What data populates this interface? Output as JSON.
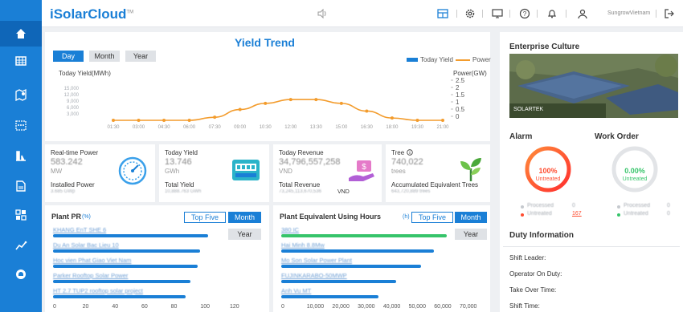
{
  "sidebar": {
    "items": [
      "home-icon",
      "grid-icon",
      "map-icon",
      "calendar-icon",
      "chart-icon",
      "report-icon",
      "apps-icon",
      "trend-icon",
      "support-icon"
    ]
  },
  "header": {
    "logo": "iSolarCloud",
    "logo_tm": "TM",
    "username": "SungrowVietnam"
  },
  "yield_trend": {
    "title": "Yield Trend",
    "tabs": [
      "Day",
      "Month",
      "Year"
    ],
    "legend_yield": "Today Yield",
    "legend_power": "Power",
    "left_axis_label": "Today Yield(MWh)",
    "right_axis_label": "Power(GW)"
  },
  "chart_data": {
    "type": "line",
    "x": [
      "01:30",
      "03:00",
      "04:30",
      "06:00",
      "07:30",
      "09:00",
      "10:30",
      "12:00",
      "13:30",
      "15:00",
      "16:30",
      "18:00",
      "19:30",
      "21:00"
    ],
    "y_left_ticks": [
      "15,000",
      "12,000",
      "9,000",
      "6,000",
      "3,000"
    ],
    "y_right_ticks": [
      "2.5",
      "2",
      "1.5",
      "1",
      "0.5",
      "0"
    ],
    "series": [
      {
        "name": "Power",
        "values": [
          0,
          0,
          0,
          0,
          0.2,
          0.7,
          1.1,
          1.35,
          1.35,
          1.1,
          0.6,
          0.15,
          0,
          0
        ]
      }
    ],
    "ylim_right": [
      0,
      2.5
    ]
  },
  "kpis": {
    "realtime": {
      "title": "Real-time Power",
      "value": "583.242",
      "unit": "MW",
      "sub_label": "Installed Power",
      "sub_value": "3.685 GWp"
    },
    "yield": {
      "title": "Today Yield",
      "value": "13.746",
      "unit": "GWh",
      "sub_label": "Total Yield",
      "sub_value": "10,888.763 GWh"
    },
    "revenue": {
      "title": "Today Revenue",
      "value": "34,796,557,258",
      "unit": "VND",
      "sub_label": "Total Revenue",
      "sub_value": "73,245,113,670,536",
      "sub_unit": "VND"
    },
    "tree": {
      "title": "Tree",
      "value": "740,022",
      "unit": "trees",
      "sub_label": "Accumulated Equivalent Trees",
      "sub_value": "643,720,889 trees"
    }
  },
  "plant_pr": {
    "title": "Plant PR",
    "unit": "(%)",
    "tab_top": "Top Five",
    "tab_month": "Month",
    "year_btn": "Year",
    "bars": [
      {
        "label": "KHANG EnT SHE 6",
        "value": 105
      },
      {
        "label": "Du An Solar Bac Lieu 10",
        "value": 100
      },
      {
        "label": "Hoc vien Phat Giao Viet Nam",
        "value": 98
      },
      {
        "label": "Parker Rooftop Solar Power",
        "value": 93
      },
      {
        "label": "HT 2.7 TUP2 rooftop solar project",
        "value": 90
      }
    ],
    "ticks": [
      "0",
      "20",
      "40",
      "60",
      "80",
      "100",
      "120"
    ]
  },
  "plant_hours": {
    "title": "Plant Equivalent Using Hours",
    "unit": "(h)",
    "tab_top": "Top Five",
    "tab_month": "Month",
    "year_btn": "Year",
    "bars": [
      {
        "label": "380 IC",
        "value": 65000
      },
      {
        "label": "Hai Minh 8.8Mw",
        "value": 60000
      },
      {
        "label": "Mo Son Solar Power Plant",
        "value": 55000
      },
      {
        "label": "FUJINKARABO-50MWP",
        "value": 45000
      },
      {
        "label": "Anh Vu MT",
        "value": 38000
      }
    ],
    "ticks": [
      "0",
      "10,000",
      "20,000",
      "30,000",
      "40,000",
      "50,000",
      "60,000",
      "70,000"
    ]
  },
  "enterprise": {
    "title": "Enterprise Culture",
    "image_caption": "SOLARTEK"
  },
  "alarm": {
    "title": "Alarm",
    "percent": "100%",
    "state": "Untreated",
    "processed_label": "Processed",
    "processed_value": "0",
    "untreated_label": "Untreated",
    "untreated_value": "167"
  },
  "work_order": {
    "title": "Work Order",
    "percent": "0.00%",
    "state": "Untreated",
    "processed_label": "Processed",
    "processed_value": "0",
    "untreated_label": "Untreated",
    "untreated_value": "0"
  },
  "duty": {
    "title": "Duty Information",
    "rows": [
      "Shift Leader:",
      "Operator On Duty:",
      "Take Over Time:",
      "Shift Time:"
    ]
  },
  "colors": {
    "primary": "#1a7fd6",
    "orange": "#f39c2d",
    "alarm_red": "#ff4d30",
    "green": "#36c46a"
  }
}
